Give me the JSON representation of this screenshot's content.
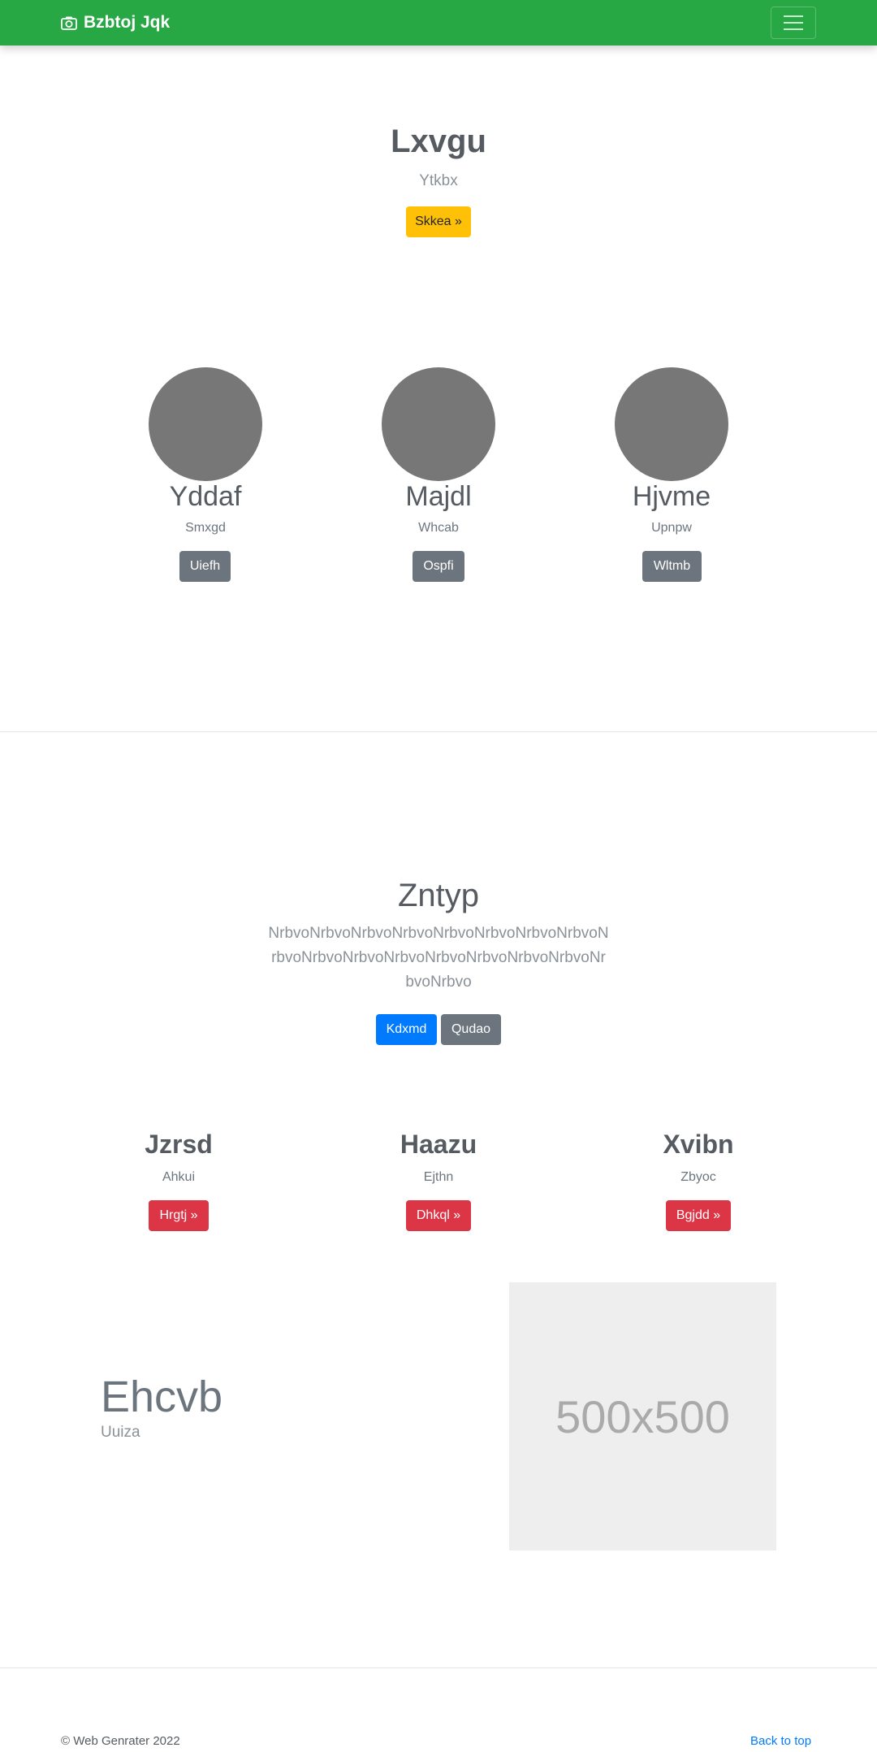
{
  "navbar": {
    "brand_icon": "camera-icon",
    "brand_text": "Bzbtoj Jqk",
    "toggler_icon": "hamburger-icon",
    "bg_color": "#28a745"
  },
  "hero": {
    "title": "Lxvgu",
    "subtitle": "Ytkbx",
    "button_label": "Skkea »"
  },
  "profiles": [
    {
      "name": "Yddaf",
      "sub": "Smxgd",
      "button": "Uiefh"
    },
    {
      "name": "Majdl",
      "sub": "Whcab",
      "button": "Ospfi"
    },
    {
      "name": "Hjvme",
      "sub": "Upnpw",
      "button": "Wltmb"
    }
  ],
  "feature": {
    "title": "Zntyp",
    "text": "NrbvoNrbvoNrbvoNrbvoNrbvoNrbvoNrbvoNrbvoNrbvoNrbvoNrbvoNrbvoNrbvoNrbvoNrbvoNrbvoNrbvoNrbvo",
    "primary_button": "Kdxmd",
    "secondary_button": "Qudao"
  },
  "columns": [
    {
      "title": "Jzrsd",
      "sub": "Ahkui",
      "button": "Hrgtj »"
    },
    {
      "title": "Haazu",
      "sub": "Ejthn",
      "button": "Dhkql »"
    },
    {
      "title": "Xvibn",
      "sub": "Zbyoc",
      "button": "Bgjdd »"
    }
  ],
  "showcase": {
    "title": "Ehcvb",
    "subtitle": "Uuiza",
    "image_placeholder": "500x500"
  },
  "footer": {
    "copyright": "© Web Genrater 2022",
    "back_to_top": "Back to top"
  }
}
